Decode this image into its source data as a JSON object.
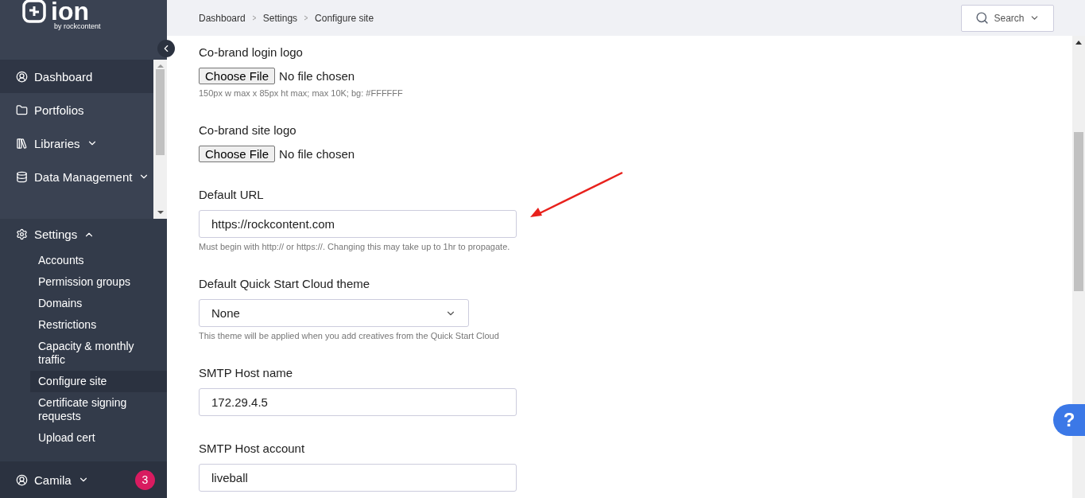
{
  "brand": {
    "name": "ion",
    "tagline": "by rockcontent"
  },
  "sidebar": {
    "items": [
      {
        "label": "Dashboard",
        "selected": true
      },
      {
        "label": "Portfolios",
        "selected": false
      },
      {
        "label": "Libraries",
        "selected": false,
        "expanded": false
      },
      {
        "label": "Data Management",
        "selected": false,
        "expanded": false
      }
    ],
    "settings": {
      "label": "Settings",
      "expanded": true,
      "children": [
        {
          "label": "Accounts",
          "selected": false
        },
        {
          "label": "Permission groups",
          "selected": false
        },
        {
          "label": "Domains",
          "selected": false
        },
        {
          "label": "Restrictions",
          "selected": false
        },
        {
          "label": "Capacity & monthly traffic",
          "selected": false
        },
        {
          "label": "Configure site",
          "selected": true
        },
        {
          "label": "Certificate signing requests",
          "selected": false
        },
        {
          "label": "Upload cert",
          "selected": false
        }
      ]
    },
    "user": {
      "name": "Camila",
      "notifications": "3"
    }
  },
  "breadcrumb": [
    "Dashboard",
    "Settings",
    "Configure site"
  ],
  "search": {
    "label": "Search"
  },
  "fields": [
    {
      "kind": "file",
      "label": "Co-brand login logo",
      "button": "Choose File",
      "value": "No file chosen",
      "help": "150px w max x 85px ht max; max 10K; bg: #FFFFFF"
    },
    {
      "kind": "file",
      "label": "Co-brand site logo",
      "button": "Choose File",
      "value": "No file chosen"
    },
    {
      "kind": "text",
      "label": "Default URL",
      "value": "https://rockcontent.com",
      "help": "Must begin with http:// or https://. Changing this may take up to 1hr to propagate.",
      "annotated": true
    },
    {
      "kind": "select",
      "label": "Default Quick Start Cloud theme",
      "value": "None",
      "help": "This theme will be applied when you add creatives from the Quick Start Cloud"
    },
    {
      "kind": "text",
      "label": "SMTP Host name",
      "value": "172.29.4.5"
    },
    {
      "kind": "text",
      "label": "SMTP Host account",
      "value": "liveball"
    }
  ],
  "help_button": {
    "label": "?"
  }
}
